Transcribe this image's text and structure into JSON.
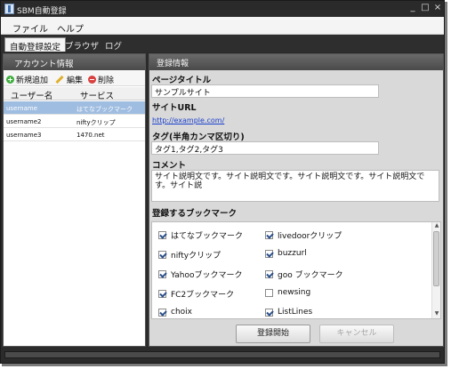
{
  "window": {
    "title": "SBM自動登録",
    "minimize": "_",
    "maximize": "□",
    "close": "×"
  },
  "menu": [
    {
      "label": "ファイル"
    },
    {
      "label": "ヘルプ"
    }
  ],
  "tabs": [
    {
      "label": "自動登録設定",
      "active": true
    },
    {
      "label": "ブラウザ"
    },
    {
      "label": "ログ"
    }
  ],
  "accounts": {
    "header": "アカウント情報",
    "toolbar": {
      "add": "新規追加",
      "edit": "編集",
      "delete": "削除"
    },
    "columns": {
      "user": "ユーザー名",
      "service": "サービス"
    },
    "rows": [
      {
        "user": "username",
        "service": "はてなブックマーク",
        "selected": true
      },
      {
        "user": "username2",
        "service": "niftyクリップ"
      },
      {
        "user": "username3",
        "service": "1470.net"
      }
    ]
  },
  "registration": {
    "header": "登録情報",
    "page_title_label": "ページタイトル",
    "page_title_value": "サンプルサイト",
    "site_url_label": "サイトURL",
    "site_url_value": "http://example.com/",
    "tags_label": "タグ(半角カンマ区切り)",
    "tags_value": "タグ1,タグ2,タグ3",
    "comment_label": "コメント",
    "comment_value": "サイト説明文です。サイト説明文です。サイト説明文です。サイト説明文です。サイト説",
    "bookmarks_label": "登録するブックマーク",
    "bookmarks": [
      {
        "label": "はてなブックマーク",
        "checked": true
      },
      {
        "label": "livedoorクリップ",
        "checked": true
      },
      {
        "label": "niftyクリップ",
        "checked": true
      },
      {
        "label": "buzzurl",
        "checked": true
      },
      {
        "label": "Yahooブックマーク",
        "checked": true
      },
      {
        "label": "goo ブックマーク",
        "checked": true
      },
      {
        "label": "FC2ブックマーク",
        "checked": true
      },
      {
        "label": "newsing",
        "checked": false
      },
      {
        "label": "choix",
        "checked": true
      },
      {
        "label": "ListLines",
        "checked": true
      }
    ],
    "start_button": "登録開始",
    "cancel_button": "キャンセル"
  },
  "colors": {
    "accent": "#9fbde0",
    "link": "#1a3fcc",
    "chrome": "#2b2b2b"
  }
}
